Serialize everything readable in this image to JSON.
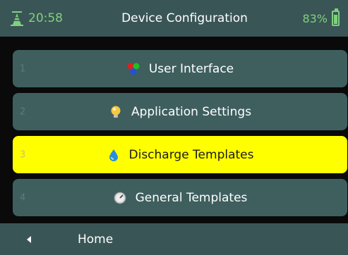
{
  "status": {
    "time": "20:58",
    "title": "Device Configuration",
    "battery": "83%",
    "battery_level": 0.83
  },
  "menu": {
    "items": [
      {
        "num": "1",
        "label": "User Interface",
        "icon": "rgb-dots-icon"
      },
      {
        "num": "2",
        "label": "Application Settings",
        "icon": "lightbulb-icon"
      },
      {
        "num": "3",
        "label": "Discharge Templates",
        "icon": "water-drop-icon",
        "selected": true
      },
      {
        "num": "4",
        "label": "General Templates",
        "icon": "gauge-icon"
      }
    ]
  },
  "footer": {
    "back_label": "Home"
  },
  "colors": {
    "bar": "#3a5555",
    "item": "#3f5f5f",
    "selected": "#ffff00",
    "accent": "#7fd17f"
  }
}
